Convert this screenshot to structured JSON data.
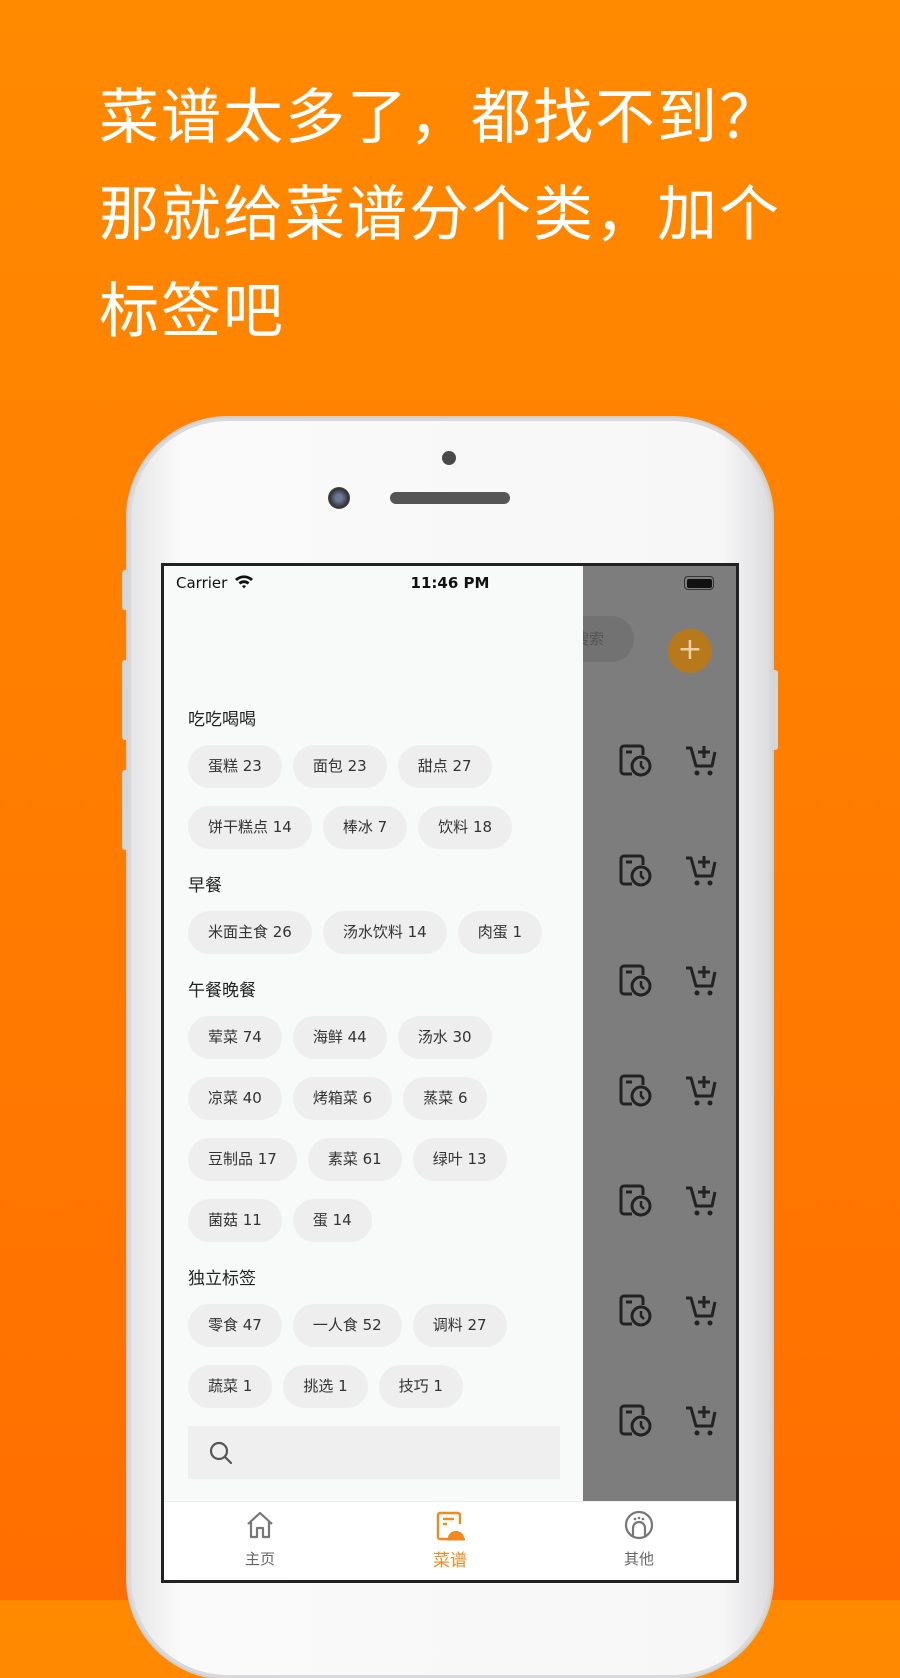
{
  "headline": [
    "菜谱太多了，都找不到？",
    "那就给菜谱分个类，加个",
    "标签吧"
  ],
  "status_bar": {
    "carrier": "Carrier",
    "time": "11:46 PM"
  },
  "background_screen": {
    "search_label": "搜索",
    "add_label": "+"
  },
  "drawer": {
    "sections": [
      {
        "title": "吃吃喝喝",
        "tags": [
          "蛋糕 23",
          "面包 23",
          "甜点 27",
          "饼干糕点 14",
          "棒冰 7",
          "饮料 18"
        ]
      },
      {
        "title": "早餐",
        "tags": [
          "米面主食 26",
          "汤水饮料 14",
          "肉蛋 1"
        ]
      },
      {
        "title": "午餐晚餐",
        "tags": [
          "荤菜 74",
          "海鲜 44",
          "汤水 30",
          "凉菜 40",
          "烤箱菜 6",
          "蒸菜 6",
          "豆制品 17",
          "素菜 61",
          "绿叶 13",
          "菌菇 11",
          "蛋 14"
        ]
      },
      {
        "title": "独立标签",
        "tags": [
          "零食 47",
          "一人食 52",
          "调料 27",
          "蔬菜 1",
          "挑选 1",
          "技巧 1"
        ]
      }
    ],
    "search_placeholder": ""
  },
  "tabbar": {
    "items": [
      {
        "label": "主页",
        "icon": "home-icon",
        "active": false
      },
      {
        "label": "菜谱",
        "icon": "recipe-icon",
        "active": true
      },
      {
        "label": "其他",
        "icon": "other-icon",
        "active": false
      }
    ]
  },
  "colors": {
    "accent": "#f08a1c",
    "background": "#ff8000",
    "overlay": "#7d7d7d"
  }
}
